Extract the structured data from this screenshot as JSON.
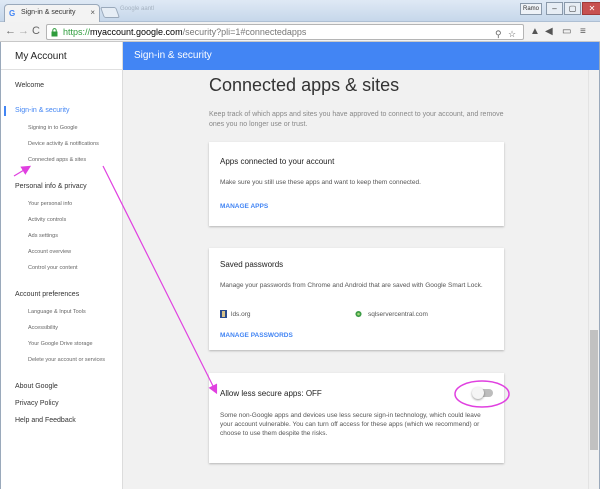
{
  "browser": {
    "tab_title": "Sign-in & security",
    "tab_close": "×",
    "tab_favicon": "G",
    "ghost_tab": "Google aantl",
    "user_badge": "Ramo",
    "window_buttons": [
      "–",
      "▢",
      "✕"
    ],
    "nav": {
      "back": "←",
      "forward": "→",
      "reload": "C"
    },
    "url_scheme": "https://",
    "url_host": "myaccount.google.com",
    "url_path": "/security?pli=1#connectedapps",
    "omnibox_icons": [
      "⚲",
      "☆"
    ],
    "extension_icons": [
      "▲",
      "◀",
      "▭",
      "≡"
    ]
  },
  "sidebar": {
    "title": "My Account",
    "welcome": "Welcome",
    "signin_security": "Sign-in & security",
    "signin_sub": [
      "Signing in to Google",
      "Device activity & notifications",
      "Connected apps & sites"
    ],
    "personal_info": "Personal info & privacy",
    "personal_sub": [
      "Your personal info",
      "Activity controls",
      "Ads settings",
      "Account overview",
      "Control your content"
    ],
    "account_prefs": "Account preferences",
    "prefs_sub": [
      "Language & Input Tools",
      "Accessibility",
      "Your Google Drive storage",
      "Delete your account or services"
    ],
    "about": "About Google",
    "privacy": "Privacy Policy",
    "help": "Help and Feedback"
  },
  "header": {
    "title": "Sign-in & security"
  },
  "main": {
    "title": "Connected apps & sites",
    "intro": "Keep track of which apps and sites you have approved to connect to your account, and remove ones you no longer use or trust.",
    "card_apps": {
      "title": "Apps connected to your account",
      "body": "Make sure you still use these apps and want to keep them connected.",
      "link": "MANAGE APPS"
    },
    "card_passwords": {
      "title": "Saved passwords",
      "body": "Manage your passwords from Chrome and Android that are saved with Google Smart Lock.",
      "site1": "lds.org",
      "site2": "sqlservercentral.com",
      "link": "MANAGE PASSWORDS"
    },
    "card_less_secure": {
      "title": "Allow less secure apps: OFF",
      "body": "Some non-Google apps and devices use less secure sign-in technology, which could leave your account vulnerable. You can turn off access for these apps (which we recommend) or choose to use them despite the risks."
    }
  },
  "colors": {
    "accent": "#4285f4",
    "annotation": "#e040e0"
  }
}
